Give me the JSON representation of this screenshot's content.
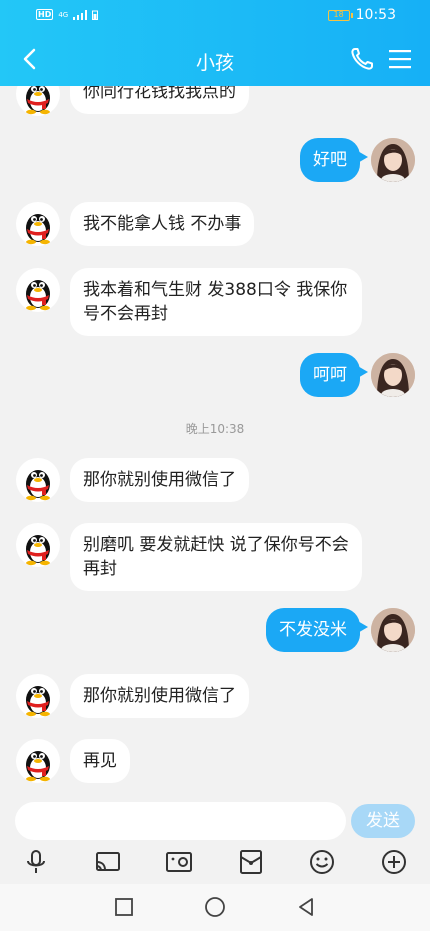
{
  "status_bar": {
    "network_label": "HD",
    "signal_label": "4G",
    "battery_level": "18",
    "time": "10:53"
  },
  "header": {
    "title": "小孩"
  },
  "icons": {
    "back": "chevron-left-icon",
    "phone": "phone-icon",
    "menu": "hamburger-menu-icon",
    "voice": "microphone-icon",
    "screen_share": "cast-icon",
    "video": "video-card-icon",
    "red_packet": "red-envelope-icon",
    "emoji": "smile-icon",
    "plus": "plus-circle-icon"
  },
  "messages": [
    {
      "side": "in",
      "text": "你同行花钱找我点的"
    },
    {
      "side": "out",
      "text": "好吧"
    },
    {
      "side": "in",
      "text": "我不能拿人钱 不办事"
    },
    {
      "side": "in",
      "text": "我本着和气生财 发388口令 我保你号不会再封"
    },
    {
      "side": "out",
      "text": "呵呵"
    },
    {
      "side": "time",
      "text": "晚上10:38"
    },
    {
      "side": "in",
      "text": "那你就别使用微信了"
    },
    {
      "side": "in",
      "text": "别磨叽 要发就赶快 说了保你号不会再封"
    },
    {
      "side": "out",
      "text": "不发没米"
    },
    {
      "side": "in",
      "text": "那你就别使用微信了"
    },
    {
      "side": "in",
      "text": "再见"
    }
  ],
  "input": {
    "value": "",
    "send_label": "发送"
  },
  "colors": {
    "header": "#1ab4f6",
    "outgoing_bubble": "#1ba8f5",
    "send_button": "#a8d8f7",
    "background": "#f2f2f2"
  }
}
